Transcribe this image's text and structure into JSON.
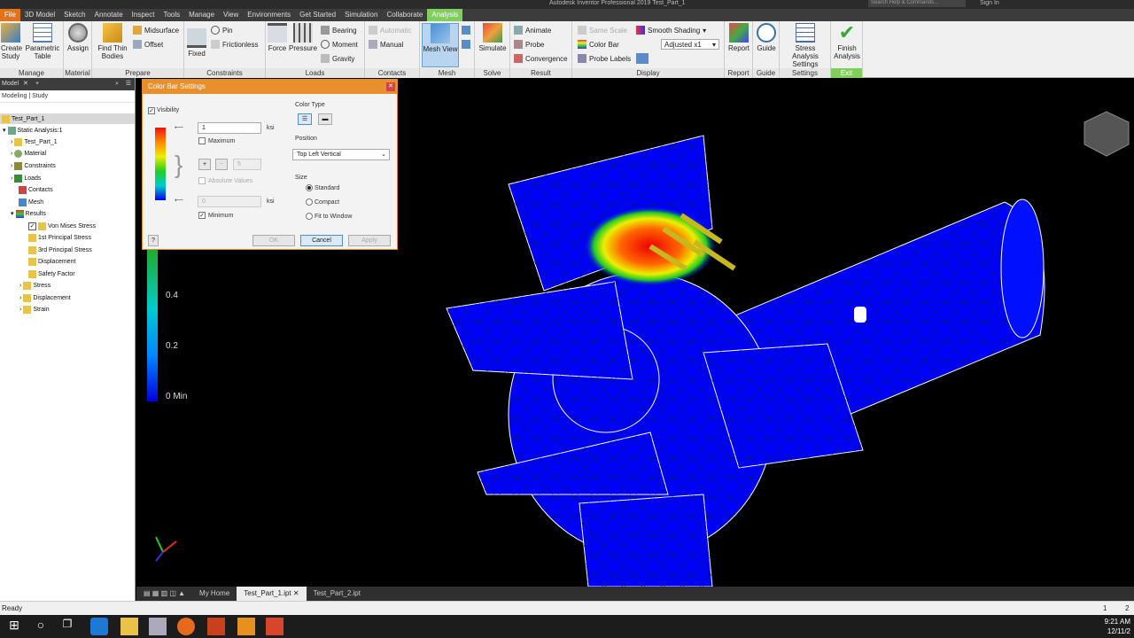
{
  "titlebar": {
    "title": "Autodesk Inventor Professional 2019   Test_Part_1",
    "search_placeholder": "Search Help & Commands...",
    "signin": "Sign In"
  },
  "menu": [
    "File",
    "3D Model",
    "Sketch",
    "Annotate",
    "Inspect",
    "Tools",
    "Manage",
    "View",
    "Environments",
    "Get Started",
    "Simulation",
    "Collaborate",
    "Analysis"
  ],
  "ribbon": {
    "manage": {
      "label": "Manage",
      "create_study": "Create Study",
      "param_table": "Parametric Table"
    },
    "material": {
      "label": "Material",
      "assign": "Assign"
    },
    "prepare": {
      "label": "Prepare",
      "find_thin": "Find Thin Bodies",
      "midsurface": "Midsurface",
      "offset": "Offset"
    },
    "constraints": {
      "label": "Constraints",
      "fixed": "Fixed",
      "pin": "Pin",
      "frictionless": "Frictionless"
    },
    "loads": {
      "label": "Loads",
      "force": "Force",
      "pressure": "Pressure",
      "bearing": "Bearing",
      "moment": "Moment",
      "gravity": "Gravity"
    },
    "contacts": {
      "label": "Contacts",
      "automatic": "Automatic",
      "manual": "Manual"
    },
    "mesh": {
      "label": "Mesh",
      "mesh_view": "Mesh View"
    },
    "solve": {
      "label": "Solve",
      "simulate": "Simulate"
    },
    "result": {
      "label": "Result",
      "animate": "Animate",
      "probe": "Probe",
      "convergence": "Convergence"
    },
    "display": {
      "label": "Display",
      "same_scale": "Same Scale",
      "color_bar": "Color Bar",
      "probe_labels": "Probe Labels",
      "smooth": "Smooth Shading",
      "adjusted": "Adjusted x1"
    },
    "report": {
      "label": "Report",
      "report": "Report"
    },
    "guide": {
      "label": "Guide",
      "guide": "Guide"
    },
    "settings": {
      "label": "Settings",
      "stress_settings": "Stress Analysis Settings"
    },
    "exit": {
      "label": "Exit",
      "finish": "Finish Analysis"
    }
  },
  "browser": {
    "header": "Model",
    "tabs": "Modeling | Study",
    "tree": [
      "Test_Part_1",
      "Static Analysis:1",
      "Test_Part_1",
      "Material",
      "Constraints",
      "Loads",
      "Contacts",
      "Mesh",
      "Results",
      "Von Mises Stress",
      "1st Principal Stress",
      "3rd Principal Stress",
      "Displacement",
      "Safety Factor",
      "Stress",
      "Displacement",
      "Strain"
    ]
  },
  "legend": {
    "values": [
      "0.4",
      "0.2",
      "0 Min"
    ]
  },
  "dialog": {
    "title": "Color Bar Settings",
    "visibility": "Visibility",
    "max_value": "1",
    "max_unit": "ksi",
    "maximum": "Maximum",
    "steps": "5",
    "absolute": "Absolute Values",
    "min_value": "0",
    "min_unit": "ksi",
    "minimum": "Minimum",
    "color_type": "Color Type",
    "position": "Position",
    "position_value": "Top Left Vertical",
    "size": "Size",
    "standard": "Standard",
    "compact": "Compact",
    "fit": "Fit to Window",
    "help": "?",
    "ok": "OK",
    "cancel": "Cancel",
    "apply": "Apply"
  },
  "docbar": {
    "home": "My Home",
    "tab1": "Test_Part_1.ipt",
    "tab2": "Test_Part_2.ipt"
  },
  "status": {
    "text": "Ready",
    "n1": "1",
    "n2": "2"
  },
  "clock": {
    "time": "9:21 AM",
    "date": "12/11/2"
  }
}
